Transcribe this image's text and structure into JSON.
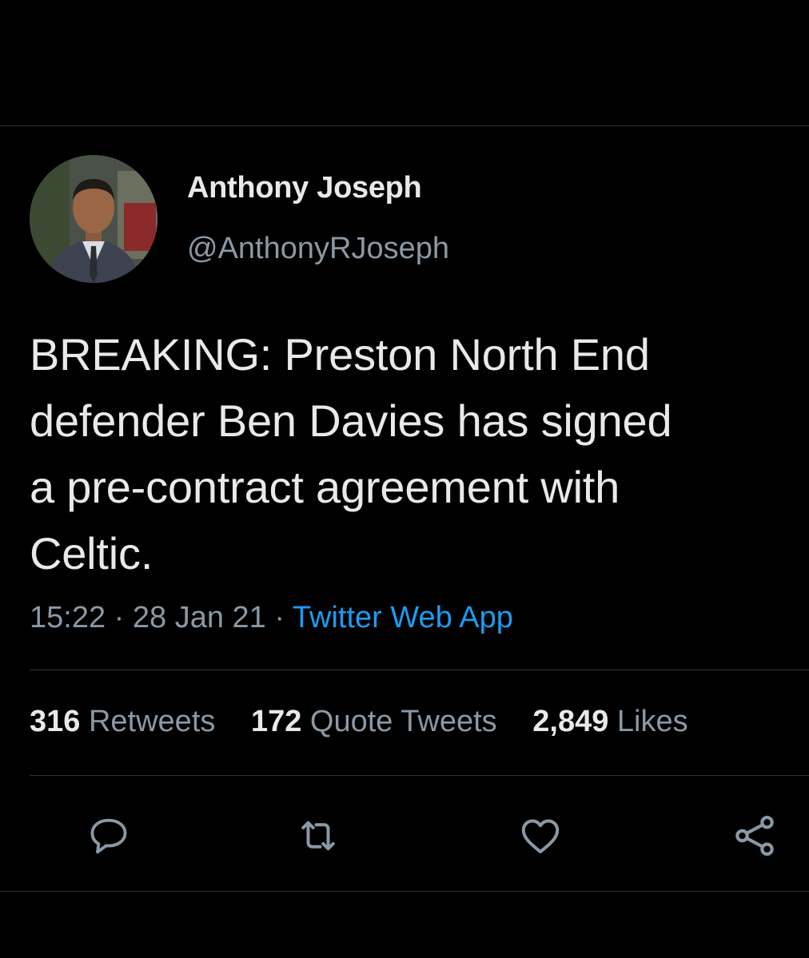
{
  "tweet": {
    "author": {
      "display_name": "Anthony Joseph",
      "handle": "@AnthonyRJoseph",
      "avatar_icon": "profile-photo"
    },
    "text_lines": [
      "BREAKING: Preston North End",
      "defender Ben Davies has signed",
      "a pre-contract agreement with",
      "Celtic."
    ],
    "time": "15:22",
    "separator": "·",
    "date": "28 Jan 21",
    "source": "Twitter Web App",
    "stats": {
      "retweets_count": "316",
      "retweets_label": "Retweets",
      "quotes_count": "172",
      "quotes_label": "Quote Tweets",
      "likes_count": "2,849",
      "likes_label": "Likes"
    },
    "actions": {
      "reply_icon": "reply-icon",
      "retweet_icon": "retweet-icon",
      "like_icon": "like-icon",
      "share_icon": "share-icon"
    }
  },
  "colors": {
    "background": "#000000",
    "text_primary": "#e7e9ea",
    "text_secondary": "#8b98a5",
    "link": "#1d9bf0",
    "divider": "#2f3336"
  }
}
